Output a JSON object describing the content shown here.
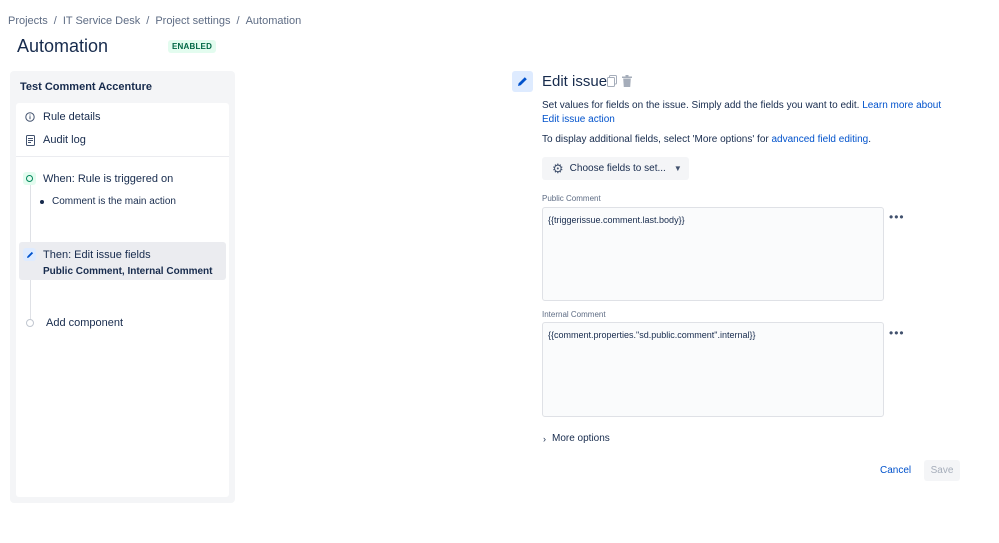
{
  "breadcrumb": [
    "Projects",
    "IT Service Desk",
    "Project settings",
    "Automation"
  ],
  "breadcrumb_separator": "/",
  "page": {
    "title": "Automation",
    "status": "ENABLED"
  },
  "rule": {
    "name": "Test Comment Accenture",
    "menu": [
      {
        "label": "Rule details",
        "icon": "info-icon"
      },
      {
        "label": "Audit log",
        "icon": "document-icon"
      }
    ],
    "trigger": {
      "label": "When: Rule is triggered on",
      "condition": "Comment is the main action"
    },
    "action": {
      "label": "Then: Edit issue fields",
      "field1": "Public Comment",
      "comma": ",",
      "field2": "Internal Comment"
    },
    "add_component": "Add component"
  },
  "editor": {
    "title": "Edit issue",
    "description": "Set values for fields on the issue. Simply add the fields you want to edit.",
    "learn_more": "Learn more about Edit issue action",
    "additional_text": "To display additional fields, select 'More options' for",
    "advanced_link": "advanced field editing",
    "period": ".",
    "choose_fields": "Choose fields to set...",
    "fields": [
      {
        "label": "Public Comment",
        "value": "{{triggerissue.comment.last.body}}"
      },
      {
        "label": "Internal Comment",
        "value": "{{comment.properties.\"sd.public.comment\".internal}}"
      }
    ],
    "more_options": "More options",
    "cancel": "Cancel",
    "save": "Save"
  },
  "colors": {
    "accent": "#0052cc",
    "enabled": "#006644",
    "enabled_bg": "#e3fcef"
  }
}
